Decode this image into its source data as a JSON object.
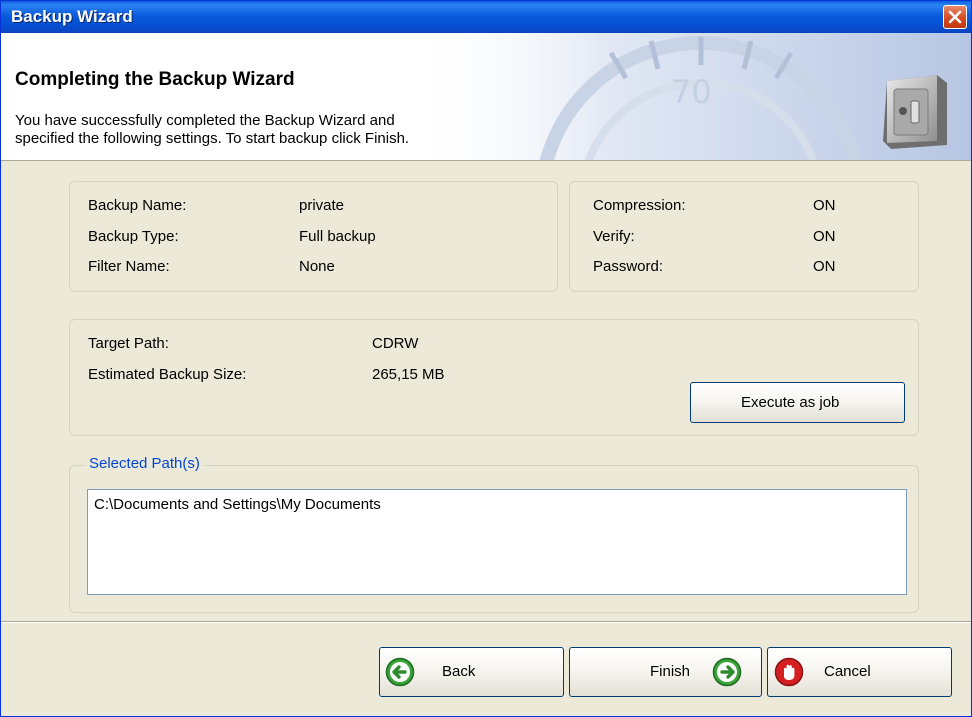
{
  "window": {
    "title": "Backup Wizard"
  },
  "header": {
    "title": "Completing the Backup Wizard",
    "description_line1": "You have successfully completed the Backup Wizard and",
    "description_line2": "specified the following settings. To start backup click Finish."
  },
  "summary": {
    "backup_name_label": "Backup Name:",
    "backup_name_value": "private",
    "backup_type_label": "Backup Type:",
    "backup_type_value": "Full backup",
    "filter_name_label": "Filter Name:",
    "filter_name_value": "None"
  },
  "options": {
    "compression_label": "Compression:",
    "compression_value": "ON",
    "verify_label": "Verify:",
    "verify_value": "ON",
    "password_label": "Password:",
    "password_value": "ON"
  },
  "target": {
    "path_label": "Target Path:",
    "path_value": "CDRW",
    "size_label": "Estimated Backup Size:",
    "size_value": "265,15 MB",
    "execute_button": "Execute as job"
  },
  "selected_paths": {
    "legend": "Selected Path(s)",
    "items": [
      "C:\\Documents and Settings\\My Documents"
    ]
  },
  "footer": {
    "back": "Back",
    "finish": "Finish",
    "cancel": "Cancel"
  },
  "colors": {
    "title_bar": "#0a5fd9",
    "legend": "#0046d5",
    "close": "#d5471d",
    "nav_arrow": "#3ba33b",
    "cancel_icon": "#d42020"
  },
  "icons": {
    "close": "close-icon",
    "safe": "safe-icon",
    "back": "back-arrow-icon",
    "finish": "forward-arrow-icon",
    "cancel": "stop-hand-icon"
  }
}
